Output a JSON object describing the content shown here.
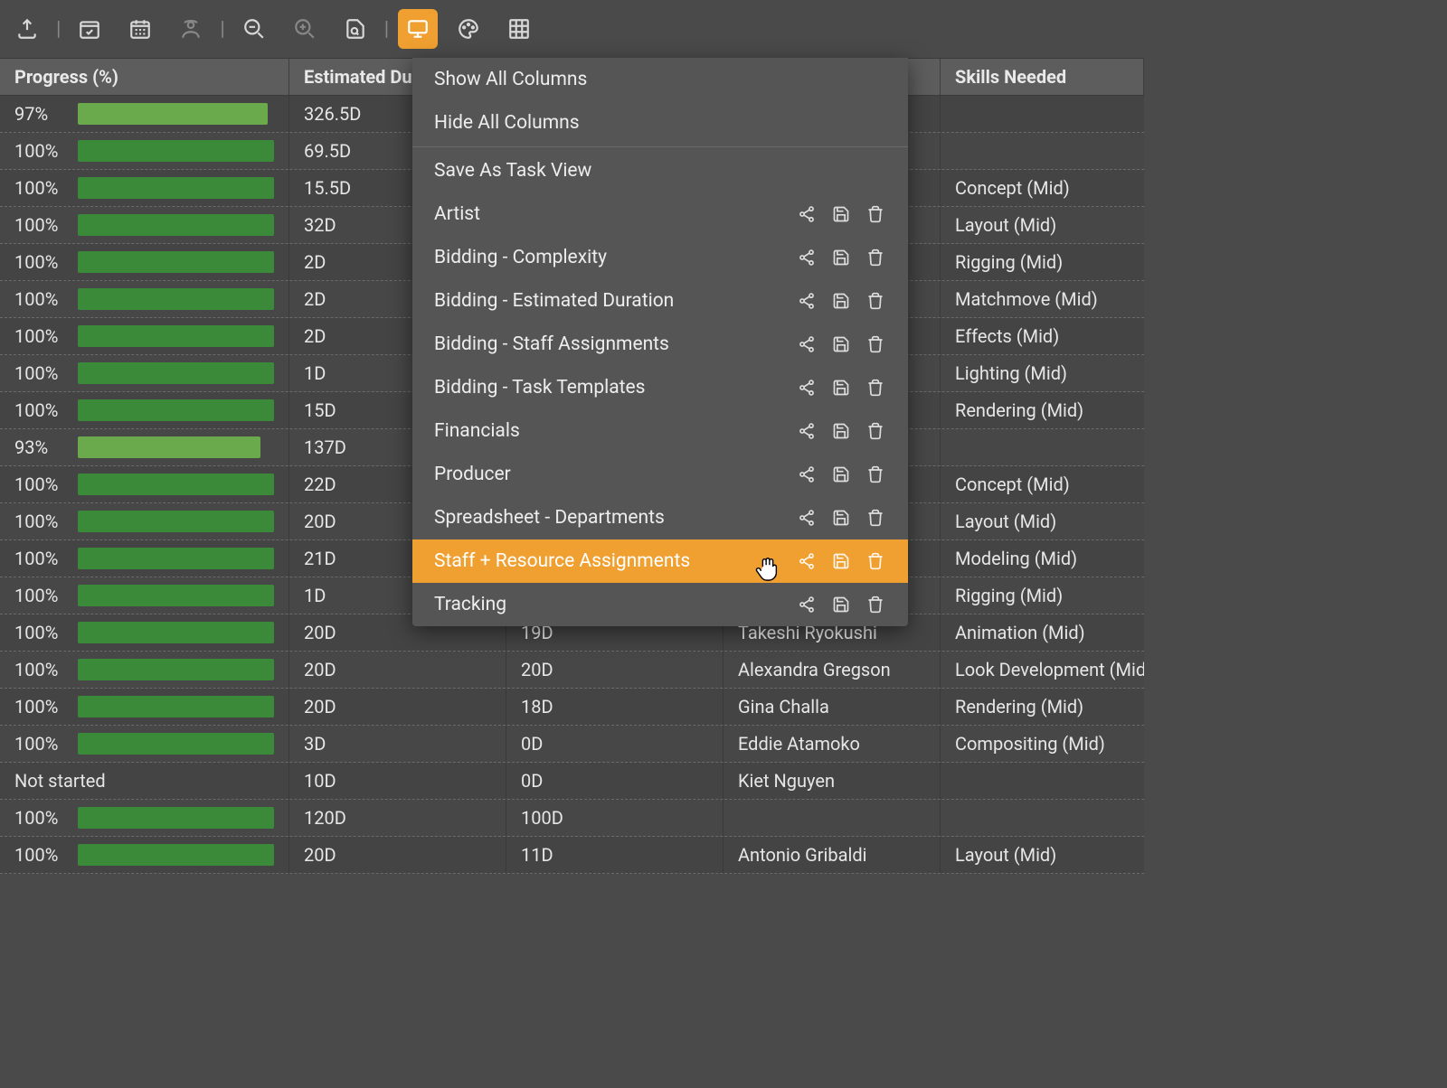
{
  "toolbar": {
    "icons": [
      "upload",
      "calendar-check",
      "calendar",
      "worker",
      "zoom-out",
      "zoom-in",
      "file-search",
      "monitor",
      "palette",
      "grid"
    ]
  },
  "columns": {
    "progress": "Progress (%)",
    "estimated": "Estimated Du",
    "actual": "",
    "who": "",
    "skills": "Skills Needed"
  },
  "menu": {
    "show_all": "Show All Columns",
    "hide_all": "Hide All Columns",
    "save_as": "Save As Task View",
    "views": [
      "Artist",
      "Bidding - Complexity",
      "Bidding - Estimated Duration",
      "Bidding - Staff Assignments",
      "Bidding - Task Templates",
      "Financials",
      "Producer",
      "Spreadsheet - Departments",
      "Staff + Resource Assignments",
      "Tracking"
    ],
    "highlighted_index": 8
  },
  "rows": [
    {
      "progress": "97%",
      "bar": "partial",
      "est": "326.5D",
      "act": "",
      "who": "",
      "skill": ""
    },
    {
      "progress": "100%",
      "bar": "full",
      "est": "69.5D",
      "act": "",
      "who": "",
      "skill": ""
    },
    {
      "progress": "100%",
      "bar": "full",
      "est": "15.5D",
      "act": "",
      "who": "",
      "skill": "Concept (Mid)"
    },
    {
      "progress": "100%",
      "bar": "full",
      "est": "32D",
      "act": "",
      "who": "",
      "skill": "Layout (Mid)"
    },
    {
      "progress": "100%",
      "bar": "full",
      "est": "2D",
      "act": "",
      "who": "",
      "skill": "Rigging (Mid)"
    },
    {
      "progress": "100%",
      "bar": "full",
      "est": "2D",
      "act": "",
      "who": "",
      "skill": "Matchmove (Mid)"
    },
    {
      "progress": "100%",
      "bar": "full",
      "est": "2D",
      "act": "",
      "who": "",
      "skill": "Effects (Mid)"
    },
    {
      "progress": "100%",
      "bar": "full",
      "est": "1D",
      "act": "",
      "who": "",
      "skill": "Lighting (Mid)"
    },
    {
      "progress": "100%",
      "bar": "full",
      "est": "15D",
      "act": "",
      "who": "",
      "skill": "Rendering (Mid)"
    },
    {
      "progress": "93%",
      "bar": "partial",
      "est": "137D",
      "act": "",
      "who": "",
      "skill": ""
    },
    {
      "progress": "100%",
      "bar": "full",
      "est": "22D",
      "act": "",
      "who": "",
      "skill": "Concept (Mid)"
    },
    {
      "progress": "100%",
      "bar": "full",
      "est": "20D",
      "act": "",
      "who": "",
      "skill": "Layout (Mid)"
    },
    {
      "progress": "100%",
      "bar": "full",
      "est": "21D",
      "act": "",
      "who": "",
      "skill": "Modeling (Mid)"
    },
    {
      "progress": "100%",
      "bar": "full",
      "est": "1D",
      "act": "",
      "who": "",
      "skill": "Rigging (Mid)"
    },
    {
      "progress": "100%",
      "bar": "full",
      "est": "20D",
      "act": "19D",
      "who": "Takeshi Ryokushi",
      "skill": "Animation (Mid)"
    },
    {
      "progress": "100%",
      "bar": "full",
      "est": "20D",
      "act": "20D",
      "who": "Alexandra Gregson",
      "skill": "Look Development (Mid)"
    },
    {
      "progress": "100%",
      "bar": "full",
      "est": "20D",
      "act": "18D",
      "who": "Gina Challa",
      "skill": "Rendering (Mid)"
    },
    {
      "progress": "100%",
      "bar": "full",
      "est": "3D",
      "act": "0D",
      "who": "Eddie Atamoko",
      "skill": "Compositing (Mid)"
    },
    {
      "progress": "Not started",
      "bar": "none",
      "est": "10D",
      "act": "0D",
      "who": "Kiet Nguyen",
      "skill": ""
    },
    {
      "progress": "100%",
      "bar": "full",
      "est": "120D",
      "act": "100D",
      "who": "",
      "skill": ""
    },
    {
      "progress": "100%",
      "bar": "full",
      "est": "20D",
      "act": "11D",
      "who": "Antonio Gribaldi",
      "skill": "Layout (Mid)"
    }
  ]
}
